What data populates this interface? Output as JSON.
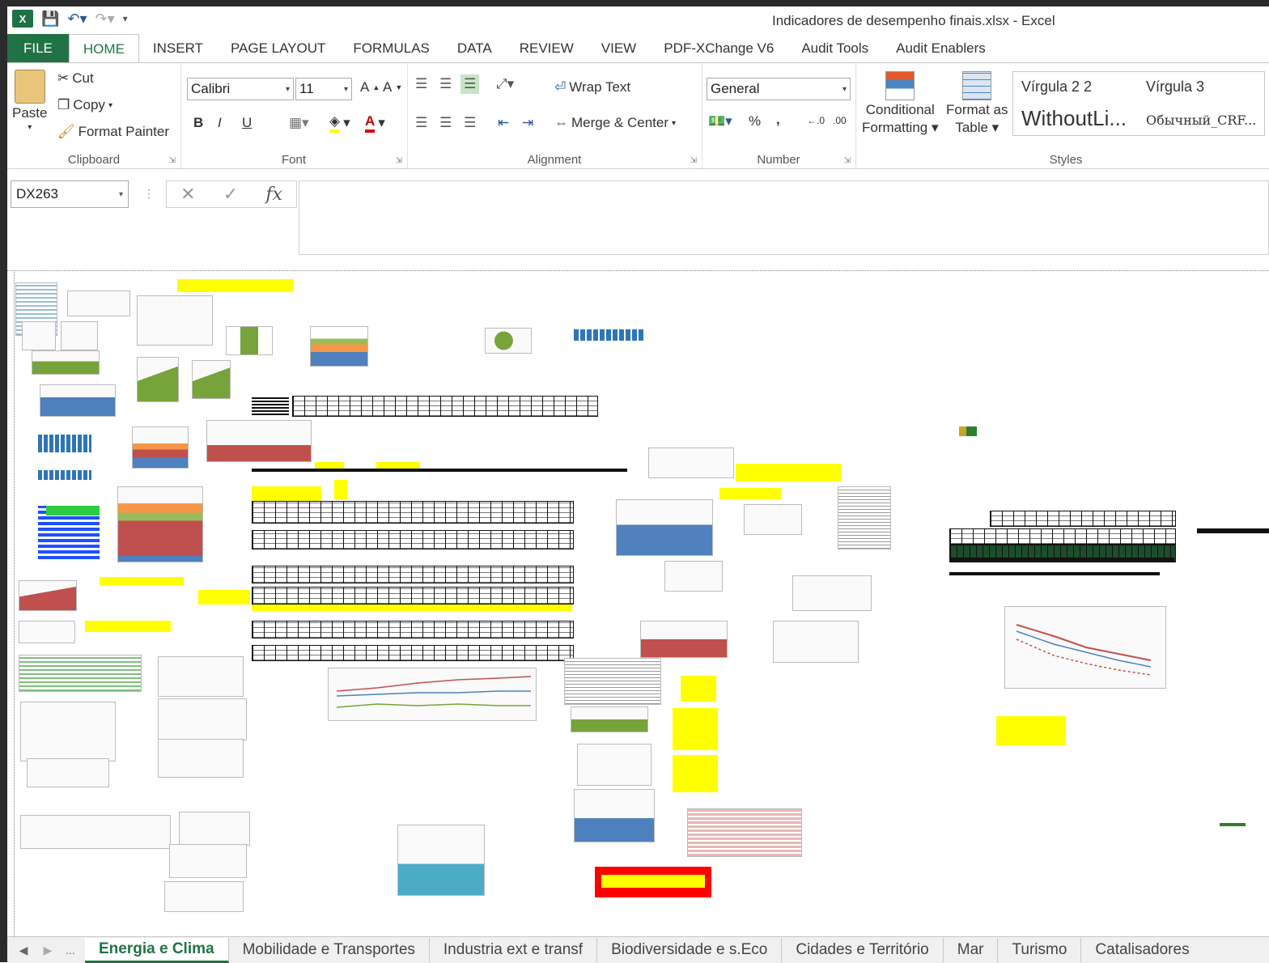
{
  "window": {
    "title": "Indicadores de desempenho finais.xlsx - Excel"
  },
  "ribbon_tabs": [
    "FILE",
    "HOME",
    "INSERT",
    "PAGE LAYOUT",
    "FORMULAS",
    "DATA",
    "REVIEW",
    "VIEW",
    "PDF-XChange V6",
    "Audit Tools",
    "Audit Enablers"
  ],
  "clipboard": {
    "paste": "Paste",
    "cut": "Cut",
    "copy": "Copy",
    "format_painter": "Format Painter",
    "label": "Clipboard"
  },
  "font": {
    "name": "Calibri",
    "size": "11",
    "label": "Font",
    "bold": "B",
    "italic": "I",
    "underline": "U"
  },
  "alignment": {
    "wrap": "Wrap Text",
    "merge": "Merge & Center",
    "label": "Alignment"
  },
  "number": {
    "format": "General",
    "percent": "%",
    "comma": ",",
    "label": "Number"
  },
  "styles": {
    "conditional": "Conditional",
    "conditional2": "Formatting",
    "format_as": "Format as",
    "format_as2": "Table",
    "s1": "Vírgula 2 2",
    "s2": "Vírgula 3",
    "s3": "WithoutLi...",
    "s4": "Обычный_CRF...",
    "label": "Styles"
  },
  "formula_bar": {
    "namebox": "DX263",
    "fx": "fx",
    "value": ""
  },
  "sheet_tabs": [
    "Energia e Clima",
    "Mobilidade e Transportes",
    "Industria ext e transf",
    "Biodiversidade e s.Eco",
    "Cidades e Território",
    "Mar",
    "Turismo",
    "Catalisadores"
  ],
  "active_sheet": "Energia e Clima",
  "nav": {
    "more": "..."
  },
  "colors": {
    "excel_green": "#217346",
    "highlight": "#ffff00",
    "font_red": "#e00000"
  }
}
